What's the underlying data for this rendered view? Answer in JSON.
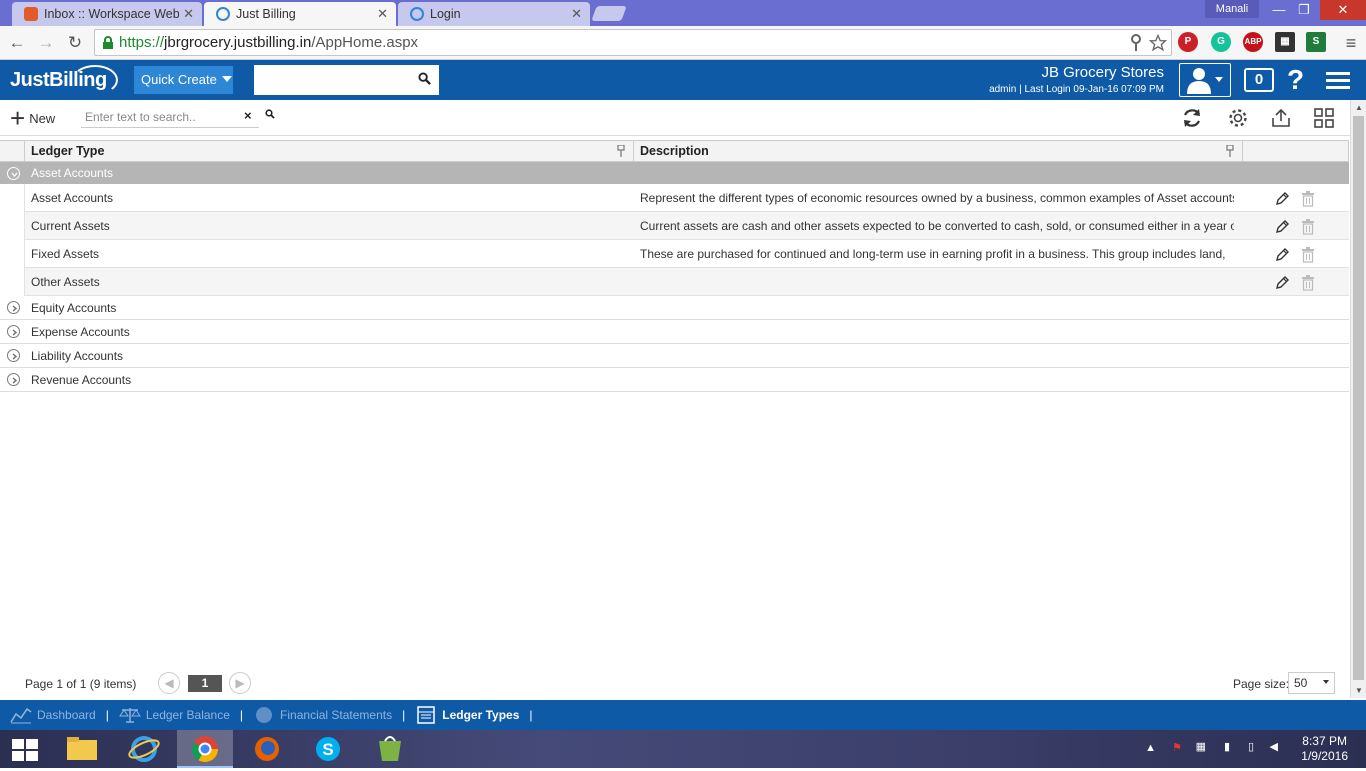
{
  "browser": {
    "tabs": [
      {
        "title": "Inbox :: Workspace Webm",
        "active": false,
        "icon": "webmail-icon"
      },
      {
        "title": "Just Billing",
        "active": true,
        "icon": "justbilling-icon"
      },
      {
        "title": "Login",
        "active": false,
        "icon": "justbilling-icon"
      }
    ],
    "profile_name": "Manali",
    "url_protocol": "https://",
    "url_host": "jbrgrocery.justbilling.in",
    "url_path": "/AppHome.aspx"
  },
  "app": {
    "logo_text": "JustBilling",
    "quick_create_label": "Quick Create",
    "search_value": "",
    "store_name": "JB Grocery Stores",
    "login_info": "admin | Last Login 09-Jan-16 07:09 PM",
    "notification_count": "0",
    "help_label": "?"
  },
  "toolbar": {
    "new_label": "New",
    "search_placeholder": "Enter text to search..",
    "search_clear": "×"
  },
  "grid": {
    "columns": [
      "Ledger Type",
      "Description"
    ],
    "expanded_group": {
      "name": "Asset Accounts",
      "rows": [
        {
          "ledger_type": "Asset Accounts",
          "description": "Represent the different types of economic resources owned by a business, common examples of Asset accounts"
        },
        {
          "ledger_type": "Current Assets",
          "description": "Current assets are cash and other assets expected to be converted to cash, sold, or consumed either in a year or"
        },
        {
          "ledger_type": "Fixed Assets",
          "description": "These are purchased for continued and long-term use in earning profit in a business. This group includes land,"
        },
        {
          "ledger_type": "Other Assets",
          "description": ""
        }
      ]
    },
    "collapsed_groups": [
      "Equity Accounts",
      "Expense Accounts",
      "Liability Accounts",
      "Revenue Accounts"
    ]
  },
  "pager": {
    "info": "Page 1 of 1 (9 items)",
    "current_page": "1",
    "page_size_label": "Page size:",
    "page_size": "50"
  },
  "bottom_nav": {
    "items": [
      {
        "label": "Dashboard",
        "icon": "dashboard-icon",
        "active": false
      },
      {
        "label": "Ledger Balance",
        "icon": "scales-icon",
        "active": false
      },
      {
        "label": "Financial Statements",
        "icon": "statement-icon",
        "active": false
      },
      {
        "label": "Ledger Types",
        "icon": "ledger-icon",
        "active": true
      }
    ]
  },
  "taskbar": {
    "time": "8:37 PM",
    "date": "1/9/2016"
  },
  "colors": {
    "brand_blue": "#0e5aa7",
    "quick_create_blue": "#2d86d6",
    "group_row_gray": "#b5b5b5",
    "chrome_tabstrip": "#6a6ed1"
  }
}
